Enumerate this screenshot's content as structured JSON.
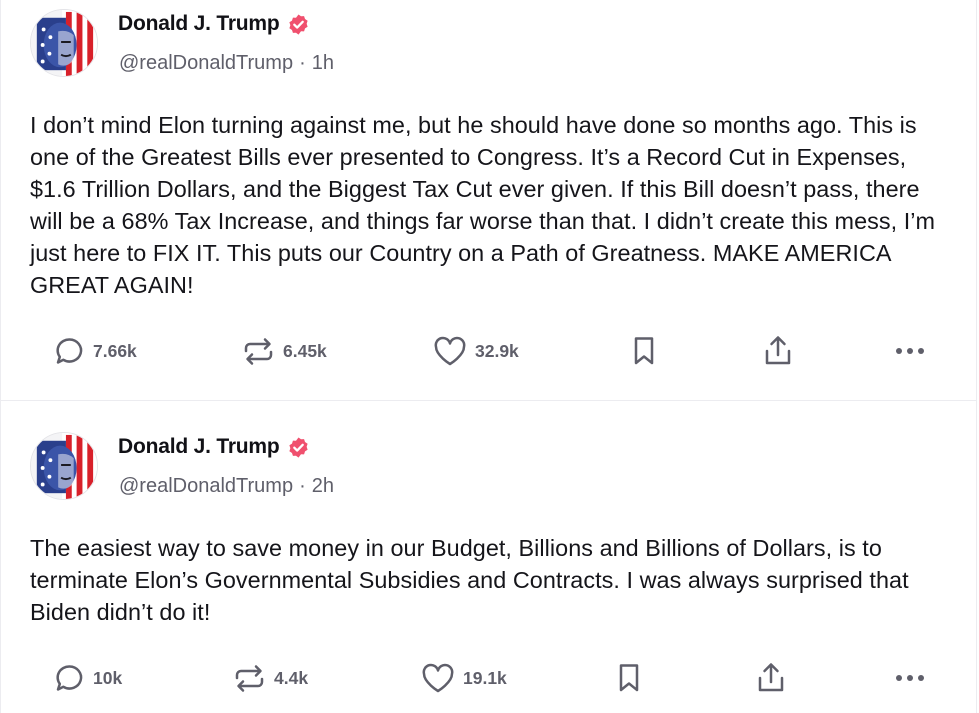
{
  "posts": [
    {
      "author": "Donald J. Trump",
      "handle": "@realDonaldTrump",
      "separator": "·",
      "time": "1h",
      "text": "I don’t mind Elon turning against me, but he should have done so months ago. This is one of the Greatest Bills ever presented to Congress. It’s a Record Cut in Expenses, $1.6 Trillion Dollars, and the Biggest Tax Cut ever given. If this Bill doesn’t pass, there will be a 68% Tax Increase, and things far worse than that. I didn’t create this mess, I’m just here to FIX IT. This puts our Country on a Path of Greatness. MAKE AMERICA GREAT AGAIN!",
      "replies": "7.66k",
      "reposts": "6.45k",
      "likes": "32.9k"
    },
    {
      "author": "Donald J. Trump",
      "handle": "@realDonaldTrump",
      "separator": "·",
      "time": "2h",
      "text": "The easiest way to save money in our Budget, Billions and Billions of Dollars, is to terminate Elon’s Governmental Subsidies and Contracts. I was always surprised that Biden didn’t do it!",
      "replies": "10k",
      "reposts": "4.4k",
      "likes": "19.1k"
    }
  ],
  "icons": {
    "verified": "verified-badge-icon",
    "reply": "speech-bubble-icon",
    "repost": "repost-arrows-icon",
    "like": "heart-icon",
    "bookmark": "bookmark-icon",
    "share": "share-upload-icon",
    "more": "ellipsis-icon"
  },
  "colors": {
    "verified": "#f0506e",
    "muted_text": "#5f5f6a",
    "body_text": "#15151a",
    "divider": "#ececf0"
  }
}
